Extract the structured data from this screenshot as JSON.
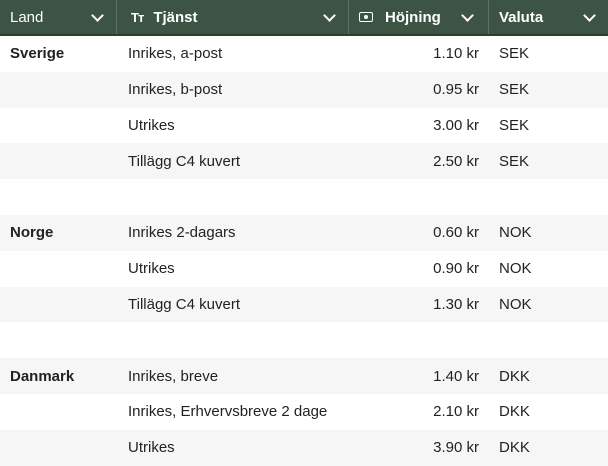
{
  "header": {
    "land": "Land",
    "tjanst_icon": "Tт",
    "tjanst": "Tjänst",
    "hojning_icon": "money-icon",
    "hojning": "Höjning",
    "valuta": "Valuta"
  },
  "rows": [
    {
      "land": "Sverige",
      "tjanst": "Inrikes, a-post",
      "hojning": "1.10 kr",
      "valuta": "SEK"
    },
    {
      "land": "",
      "tjanst": "Inrikes, b-post",
      "hojning": "0.95 kr",
      "valuta": "SEK"
    },
    {
      "land": "",
      "tjanst": "Utrikes",
      "hojning": "3.00 kr",
      "valuta": "SEK"
    },
    {
      "land": "",
      "tjanst": "Tillägg C4 kuvert",
      "hojning": "2.50 kr",
      "valuta": "SEK"
    },
    {
      "land": "",
      "tjanst": "",
      "hojning": "",
      "valuta": ""
    },
    {
      "land": "Norge",
      "tjanst": "Inrikes 2-dagars",
      "hojning": "0.60 kr",
      "valuta": "NOK"
    },
    {
      "land": "",
      "tjanst": "Utrikes",
      "hojning": "0.90 kr",
      "valuta": "NOK"
    },
    {
      "land": "",
      "tjanst": "Tillägg C4 kuvert",
      "hojning": "1.30 kr",
      "valuta": "NOK"
    },
    {
      "land": "",
      "tjanst": "",
      "hojning": "",
      "valuta": ""
    },
    {
      "land": "Danmark",
      "tjanst": "Inrikes, breve",
      "hojning": "1.40 kr",
      "valuta": "DKK"
    },
    {
      "land": "",
      "tjanst": "Inrikes, Erhvervsbreve 2 dage",
      "hojning": "2.10 kr",
      "valuta": "DKK"
    },
    {
      "land": "",
      "tjanst": "Utrikes",
      "hojning": "3.90 kr",
      "valuta": "DKK"
    }
  ]
}
